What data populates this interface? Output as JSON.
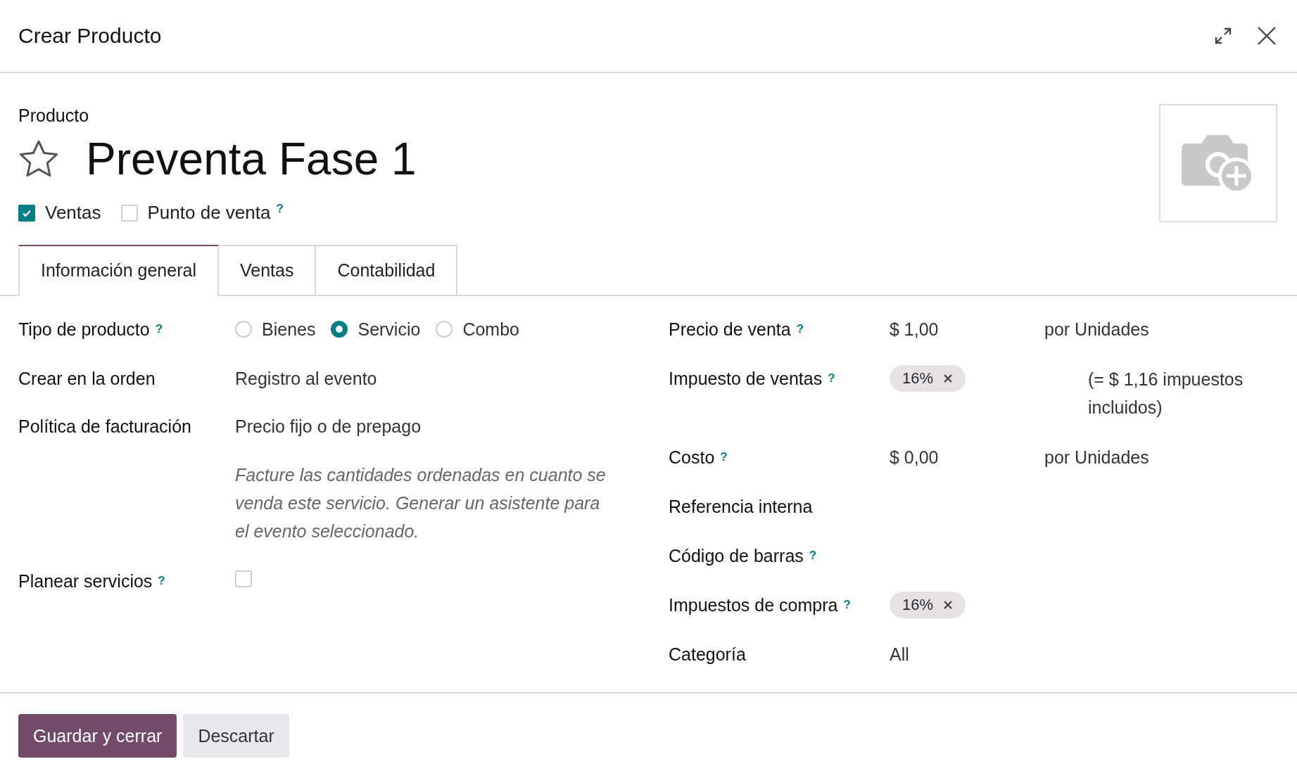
{
  "window": {
    "title": "Crear Producto"
  },
  "product": {
    "label": "Producto",
    "name": "Preventa Fase 1",
    "favorite": false
  },
  "flags": [
    {
      "label": "Ventas",
      "checked": true
    },
    {
      "label": "Punto de venta",
      "checked": false,
      "help": "?"
    }
  ],
  "tabs": [
    {
      "label": "Información general",
      "selected": true
    },
    {
      "label": "Ventas",
      "selected": false
    },
    {
      "label": "Contabilidad",
      "selected": false
    }
  ],
  "left_fields": [
    {
      "label": "Tipo de producto",
      "help": "?",
      "kind": "radio",
      "options": [
        {
          "label": "Bienes",
          "selected": false
        },
        {
          "label": "Servicio",
          "selected": true
        },
        {
          "label": "Combo",
          "selected": false
        }
      ]
    },
    {
      "label": "Crear en la orden",
      "kind": "text",
      "value": "Registro al evento"
    },
    {
      "label": "Política de facturación",
      "kind": "text",
      "value": "Precio fijo o de prepago",
      "note": "Facture las cantidades ordenadas en cuanto se venda este servicio. Generar un asistente para el evento seleccionado."
    },
    {
      "label": "Planear servicios",
      "help": "?",
      "kind": "checkbox",
      "checked": false
    }
  ],
  "right_fields": [
    {
      "label": "Precio de venta",
      "help": "?",
      "kind": "amount",
      "value": "$ 1,00",
      "unit": "por Unidades"
    },
    {
      "label": "Impuesto de ventas",
      "help": "?",
      "kind": "tags",
      "tags": [
        "16%"
      ],
      "note": "(= $ 1,16 impuestos incluidos)"
    },
    {
      "label": "Costo",
      "help": "?",
      "kind": "amount",
      "value": "$ 0,00",
      "unit": "por Unidades"
    },
    {
      "label": "Referencia interna",
      "kind": "empty"
    },
    {
      "label": "Código de barras",
      "help": "?",
      "kind": "empty"
    },
    {
      "label": "Impuestos de compra",
      "help": "?",
      "kind": "tags",
      "tags": [
        "16%"
      ]
    },
    {
      "label": "Categoría",
      "kind": "text",
      "value": "All"
    }
  ],
  "buttons": [
    {
      "label": "Guardar y cerrar",
      "kind": "primary"
    },
    {
      "label": "Descartar",
      "kind": "secondary"
    }
  ]
}
